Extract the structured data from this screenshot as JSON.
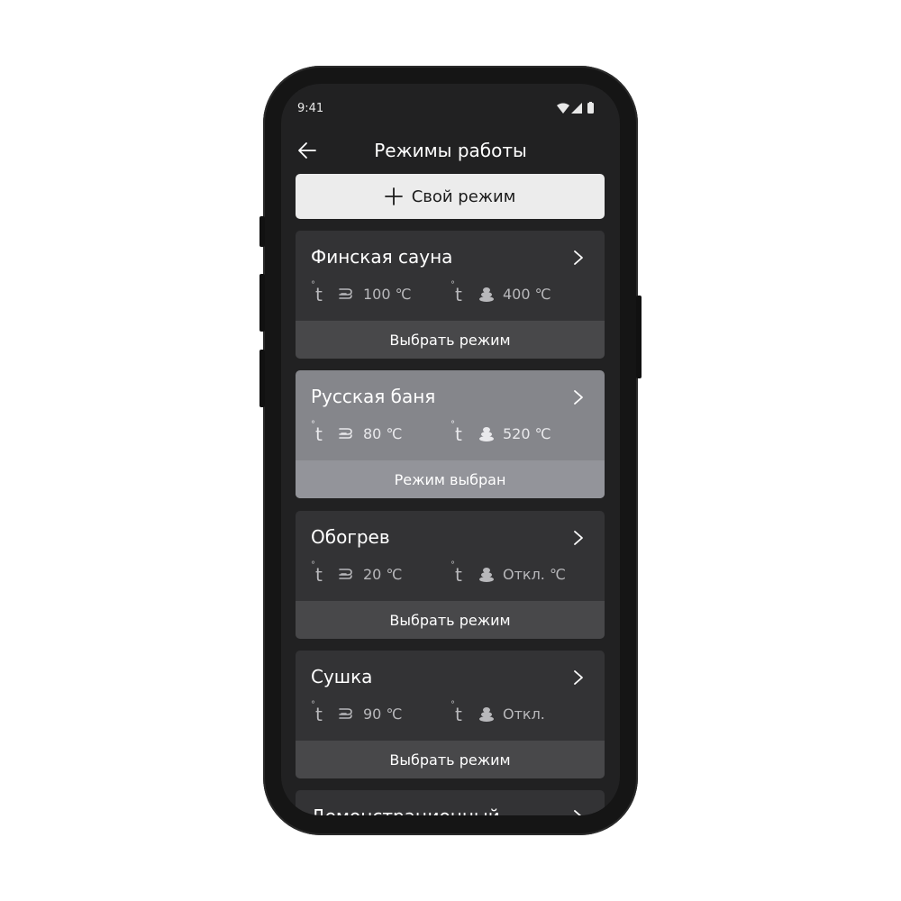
{
  "status_bar": {
    "time": "9:41",
    "icons": [
      "wifi-icon",
      "signal-icon",
      "battery-icon"
    ]
  },
  "header": {
    "title": "Режимы работы",
    "back_icon": "arrow-left-icon"
  },
  "add_mode": {
    "label": "Свой режим",
    "icon": "plus-icon"
  },
  "modes": [
    {
      "name": "Финская сауна",
      "air_temp": "100 ℃",
      "stone_temp": "400 ℃",
      "action": "Выбрать режим",
      "selected": false
    },
    {
      "name": "Русская баня",
      "air_temp": "80 ℃",
      "stone_temp": "520 ℃",
      "action": "Режим выбран",
      "selected": true
    },
    {
      "name": "Обогрев",
      "air_temp": "20 ℃",
      "stone_temp": "Откл. ℃",
      "action": "Выбрать режим",
      "selected": false
    },
    {
      "name": "Сушка",
      "air_temp": "90 ℃",
      "stone_temp": "Откл.",
      "action": "Выбрать режим",
      "selected": false
    },
    {
      "name": "Демонстрационный",
      "air_temp": "",
      "stone_temp": "",
      "action": "",
      "selected": false
    }
  ],
  "colors": {
    "screen_bg": "#212122",
    "card_bg": "#333335",
    "card_selected_bg": "#85868b",
    "action_bg": "#48484a",
    "accent_button": "#ececec"
  }
}
